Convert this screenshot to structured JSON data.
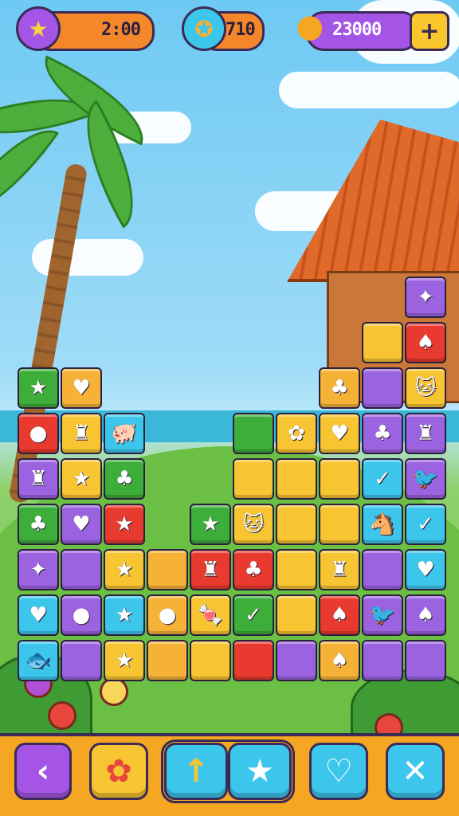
{
  "hud": {
    "timer": {
      "value": "2:00",
      "icon": "star-icon"
    },
    "moves": {
      "value": "710",
      "icon": "flame-coin-icon"
    },
    "coins": {
      "value": "23000",
      "icon": "drop-icon"
    },
    "add_icon": "plus-icon"
  },
  "board": {
    "colors": {
      "red": "#e83a2e",
      "green": "#3dae3a",
      "yellow": "#f7c531",
      "orange": "#f5b236",
      "purple": "#9b63e0",
      "cyan": "#3cc6ec"
    },
    "tiles": [
      {
        "col": 0,
        "row": 1,
        "color": "green",
        "icon": "★",
        "icon_name": "star-icon"
      },
      {
        "col": 1,
        "row": 1,
        "color": "orange",
        "icon": "♥",
        "icon_name": "heart-icon"
      },
      {
        "col": 0,
        "row": 2,
        "color": "red",
        "icon": "●",
        "icon_name": "balloon-icon"
      },
      {
        "col": 1,
        "row": 2,
        "color": "yellow",
        "icon": "♜",
        "icon_name": "bottle-icon"
      },
      {
        "col": 2,
        "row": 2,
        "color": "cyan",
        "icon": "🐖",
        "icon_name": "pig-icon"
      },
      {
        "col": 0,
        "row": 3,
        "color": "purple",
        "icon": "♜",
        "icon_name": "bottle-icon"
      },
      {
        "col": 1,
        "row": 3,
        "color": "yellow",
        "icon": "★",
        "icon_name": "star-icon"
      },
      {
        "col": 2,
        "row": 3,
        "color": "green",
        "icon": "♣",
        "icon_name": "leaf-icon"
      },
      {
        "col": 0,
        "row": 4,
        "color": "green",
        "icon": "♣",
        "icon_name": "leaf-icon"
      },
      {
        "col": 1,
        "row": 4,
        "color": "purple",
        "icon": "♥",
        "icon_name": "heart-icon"
      },
      {
        "col": 2,
        "row": 4,
        "color": "red",
        "icon": "★",
        "icon_name": "star-icon"
      },
      {
        "col": 0,
        "row": 5,
        "color": "purple",
        "icon": "✦",
        "icon_name": "fish-icon"
      },
      {
        "col": 1,
        "row": 5,
        "color": "purple",
        "icon": "",
        "icon_name": "blank-icon"
      },
      {
        "col": 2,
        "row": 5,
        "color": "yellow",
        "icon": "★",
        "icon_name": "star-icon"
      },
      {
        "col": 3,
        "row": 5,
        "color": "orange",
        "icon": "",
        "icon_name": "blank-icon"
      },
      {
        "col": 0,
        "row": 6,
        "color": "cyan",
        "icon": "♥",
        "icon_name": "heart-icon"
      },
      {
        "col": 1,
        "row": 6,
        "color": "purple",
        "icon": "●",
        "icon_name": "chick-icon"
      },
      {
        "col": 2,
        "row": 6,
        "color": "cyan",
        "icon": "★",
        "icon_name": "star-icon"
      },
      {
        "col": 3,
        "row": 6,
        "color": "orange",
        "icon": "●",
        "icon_name": "chick-icon"
      },
      {
        "col": 0,
        "row": 7,
        "color": "cyan",
        "icon": "🐟",
        "icon_name": "fish-icon"
      },
      {
        "col": 1,
        "row": 7,
        "color": "purple",
        "icon": "",
        "icon_name": "blank-icon"
      },
      {
        "col": 2,
        "row": 7,
        "color": "yellow",
        "icon": "★",
        "icon_name": "star-icon"
      },
      {
        "col": 3,
        "row": 7,
        "color": "orange",
        "icon": "",
        "icon_name": "blank-icon"
      },
      {
        "col": 4,
        "row": 4,
        "color": "green",
        "icon": "★",
        "icon_name": "star-icon"
      },
      {
        "col": 4,
        "row": 5,
        "color": "red",
        "icon": "♜",
        "icon_name": "bottle-icon"
      },
      {
        "col": 4,
        "row": 6,
        "color": "yellow",
        "icon": "🍬",
        "icon_name": "candy-icon"
      },
      {
        "col": 4,
        "row": 7,
        "color": "yellow",
        "icon": "",
        "icon_name": "blank-icon"
      },
      {
        "col": 5,
        "row": 2,
        "color": "green",
        "icon": "",
        "icon_name": "bush-icon"
      },
      {
        "col": 5,
        "row": 3,
        "color": "yellow",
        "icon": "",
        "icon_name": "blank-icon"
      },
      {
        "col": 5,
        "row": 4,
        "color": "yellow",
        "icon": "🐱",
        "icon_name": "cat-icon"
      },
      {
        "col": 5,
        "row": 5,
        "color": "red",
        "icon": "♣",
        "icon_name": "blob-icon"
      },
      {
        "col": 5,
        "row": 6,
        "color": "green",
        "icon": "✓",
        "icon_name": "check-icon"
      },
      {
        "col": 5,
        "row": 7,
        "color": "red",
        "icon": "",
        "icon_name": "blank-icon"
      },
      {
        "col": 6,
        "row": 2,
        "color": "yellow",
        "icon": "✿",
        "icon_name": "flower-icon"
      },
      {
        "col": 6,
        "row": 3,
        "color": "yellow",
        "icon": "",
        "icon_name": "blank-icon"
      },
      {
        "col": 6,
        "row": 4,
        "color": "yellow",
        "icon": "",
        "icon_name": "blank-icon"
      },
      {
        "col": 6,
        "row": 5,
        "color": "yellow",
        "icon": "",
        "icon_name": "blank-icon"
      },
      {
        "col": 6,
        "row": 6,
        "color": "yellow",
        "icon": "",
        "icon_name": "blank-icon"
      },
      {
        "col": 6,
        "row": 7,
        "color": "purple",
        "icon": "",
        "icon_name": "blank-icon"
      },
      {
        "col": 7,
        "row": 1,
        "color": "orange",
        "icon": "♣",
        "icon_name": "leaf-icon"
      },
      {
        "col": 7,
        "row": 2,
        "color": "yellow",
        "icon": "♥",
        "icon_name": "heart-icon"
      },
      {
        "col": 7,
        "row": 3,
        "color": "yellow",
        "icon": "",
        "icon_name": "blank-icon"
      },
      {
        "col": 7,
        "row": 4,
        "color": "yellow",
        "icon": "",
        "icon_name": "blank-icon"
      },
      {
        "col": 7,
        "row": 5,
        "color": "yellow",
        "icon": "♜",
        "icon_name": "bottle-icon"
      },
      {
        "col": 7,
        "row": 6,
        "color": "red",
        "icon": "♠",
        "icon_name": "shoe-icon"
      },
      {
        "col": 7,
        "row": 7,
        "color": "orange",
        "icon": "♠",
        "icon_name": "glove-icon"
      },
      {
        "col": 8,
        "row": 0,
        "color": "yellow",
        "icon": "",
        "icon_name": "blank-icon"
      },
      {
        "col": 8,
        "row": 1,
        "color": "purple",
        "icon": "",
        "icon_name": "blank-icon"
      },
      {
        "col": 8,
        "row": 2,
        "color": "purple",
        "icon": "♣",
        "icon_name": "blob-icon"
      },
      {
        "col": 8,
        "row": 3,
        "color": "cyan",
        "icon": "✓",
        "icon_name": "check-icon"
      },
      {
        "col": 8,
        "row": 4,
        "color": "cyan",
        "icon": "🐴",
        "icon_name": "horse-icon"
      },
      {
        "col": 8,
        "row": 5,
        "color": "purple",
        "icon": "",
        "icon_name": "blank-icon"
      },
      {
        "col": 8,
        "row": 6,
        "color": "purple",
        "icon": "🐦",
        "icon_name": "bird-icon"
      },
      {
        "col": 8,
        "row": 7,
        "color": "purple",
        "icon": "",
        "icon_name": "blank-icon"
      },
      {
        "col": 9,
        "row": -1,
        "color": "purple",
        "icon": "✦",
        "icon_name": "fish-icon"
      },
      {
        "col": 9,
        "row": 0,
        "color": "red",
        "icon": "♠",
        "icon_name": "feather-icon"
      },
      {
        "col": 9,
        "row": 1,
        "color": "yellow",
        "icon": "🐱",
        "icon_name": "cat-icon"
      },
      {
        "col": 9,
        "row": 2,
        "color": "purple",
        "icon": "♜",
        "icon_name": "bottle-icon"
      },
      {
        "col": 9,
        "row": 3,
        "color": "purple",
        "icon": "🐦",
        "icon_name": "bird-icon"
      },
      {
        "col": 9,
        "row": 4,
        "color": "cyan",
        "icon": "✓",
        "icon_name": "check-icon"
      },
      {
        "col": 9,
        "row": 5,
        "color": "cyan",
        "icon": "♥",
        "icon_name": "blob-icon"
      },
      {
        "col": 9,
        "row": 6,
        "color": "purple",
        "icon": "♠",
        "icon_name": "bucket-icon"
      },
      {
        "col": 9,
        "row": 7,
        "color": "purple",
        "icon": "",
        "icon_name": "blank-icon"
      }
    ]
  },
  "bottom_bar": {
    "buttons": [
      {
        "name": "back-button",
        "icon": "‹",
        "icon_name": "chevron-left-icon",
        "color": "#a455e6"
      },
      {
        "name": "settings-button",
        "icon": "✿",
        "icon_name": "gear-icon",
        "color": "#f7c531"
      },
      {
        "name": "hammer-booster-button",
        "icon": "↑",
        "icon_name": "hammer-icon",
        "color": "#3cc6ec"
      },
      {
        "name": "star-booster-button",
        "icon": "★",
        "icon_name": "star-icon",
        "color": "#3cc6ec"
      },
      {
        "name": "lives-button",
        "icon": "♡",
        "icon_name": "heart-icon",
        "color": "#3cc6ec"
      },
      {
        "name": "close-button",
        "icon": "✕",
        "icon_name": "close-icon",
        "color": "#3cc6ec"
      }
    ]
  }
}
